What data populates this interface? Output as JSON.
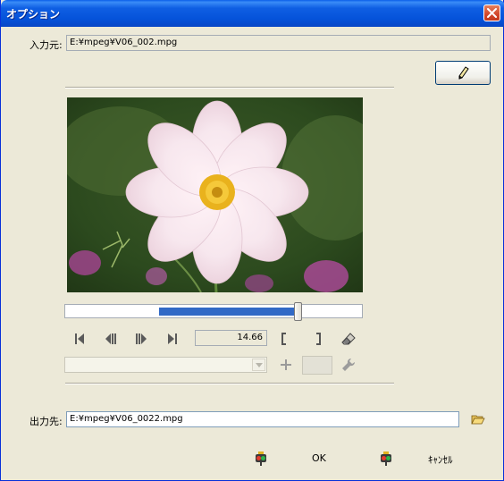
{
  "window": {
    "title": "オプション",
    "close_icon": "close-icon"
  },
  "input": {
    "label": "入力元:",
    "value": "E:¥mpeg¥V06_002.mpg"
  },
  "edit_button": {
    "icon": "pencil-icon"
  },
  "preview": {
    "subject": "flower-photo"
  },
  "seek": {
    "position_fraction": 0.77,
    "selection_start_fraction": 0.315
  },
  "controls": {
    "first_icon": "skip-to-start-icon",
    "prev_frame_icon": "step-back-icon",
    "next_frame_icon": "step-forward-icon",
    "last_icon": "skip-to-end-icon",
    "time": "14.66",
    "mark_in_icon": "mark-in-bracket-icon",
    "mark_out_icon": "mark-out-bracket-icon",
    "eraser_icon": "eraser-icon"
  },
  "preset": {
    "value": "",
    "add_icon": "plus-icon",
    "settings_icon": "wrench-icon"
  },
  "output": {
    "label": "出力先:",
    "value": "E:¥mpeg¥V06_0022.mpg",
    "browse_icon": "open-folder-icon"
  },
  "buttons": {
    "ok_label": "OK",
    "cancel_label": "ｷｬﾝｾﾙ",
    "ok_icon": "traffic-light-icon",
    "cancel_icon": "traffic-light-icon"
  },
  "colors": {
    "titlebar": "#0553da",
    "window_bg": "#ece9d8",
    "seek_fill": "#3169c6",
    "close": "#d2462a"
  }
}
